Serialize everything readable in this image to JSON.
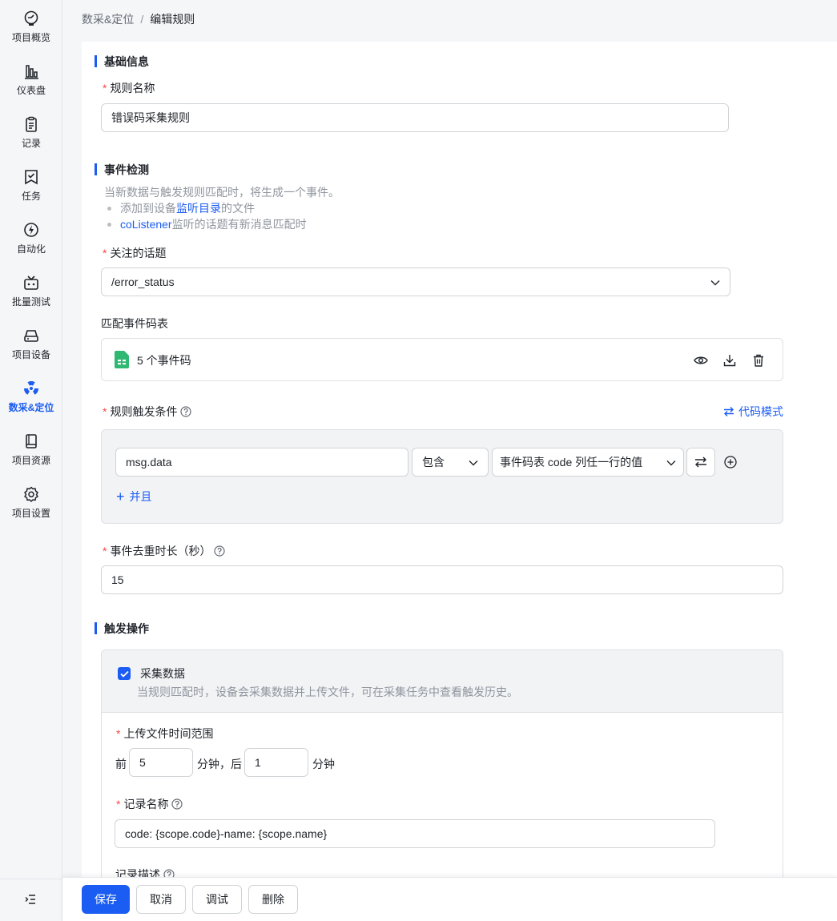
{
  "nav": [
    {
      "label": "项目概览",
      "icon": "dashboard-gauge-icon",
      "active": false
    },
    {
      "label": "仪表盘",
      "icon": "bar-chart-icon",
      "active": false
    },
    {
      "label": "记录",
      "icon": "clipboard-icon",
      "active": false
    },
    {
      "label": "任务",
      "icon": "task-checklist-icon",
      "active": false
    },
    {
      "label": "自动化",
      "icon": "automation-icon",
      "active": false
    },
    {
      "label": "批量测试",
      "icon": "batch-test-icon",
      "active": false
    },
    {
      "label": "项目设备",
      "icon": "device-drive-icon",
      "active": false
    },
    {
      "label": "数采&定位",
      "icon": "radiation-icon",
      "active": true
    },
    {
      "label": "项目资源",
      "icon": "book-icon",
      "active": false
    },
    {
      "label": "项目设置",
      "icon": "gear-icon",
      "active": false
    }
  ],
  "breadcrumb": {
    "parent": "数采&定位",
    "separator": "/",
    "current": "编辑规则"
  },
  "basic": {
    "title": "基础信息",
    "rule_name_label": "规则名称",
    "rule_name_value": "错误码采集规则"
  },
  "event": {
    "title": "事件检测",
    "desc": "当新数据与触发规则匹配时，将生成一个事件。",
    "bullet1_prefix": "添加到设备",
    "bullet1_link": "监听目录",
    "bullet1_suffix": "的文件",
    "bullet2_link": "coListener",
    "bullet2_suffix": "监听的话题有新消息匹配时",
    "topic_label": "关注的话题",
    "topic_value": "/error_status",
    "code_table_label": "匹配事件码表",
    "code_table_file": "5 个事件码",
    "trigger_label": "规则触发条件",
    "code_mode": "代码模式",
    "condition_field": "msg.data",
    "condition_operator": "包含",
    "condition_value": "事件码表 code 列任一行的值",
    "and_label": "并且",
    "dedup_label": "事件去重时长（秒）",
    "dedup_value": "15"
  },
  "action": {
    "title": "触发操作",
    "collect_title": "采集数据",
    "collect_checked": true,
    "collect_desc": "当规则匹配时，设备会采集数据并上传文件，可在采集任务中查看触发历史。",
    "time_range_label": "上传文件时间范围",
    "before_label": "前",
    "before_value": "5",
    "after_prefix": "分钟，后",
    "after_value": "1",
    "after_suffix": "分钟",
    "record_name_label": "记录名称",
    "record_name_value": "code: {scope.code}-name: {scope.name}",
    "record_desc_label": "记录描述"
  },
  "footer": {
    "save": "保存",
    "cancel": "取消",
    "debug": "调试",
    "delete": "删除"
  },
  "colors": {
    "accent": "#1b5cf2",
    "required": "#f54a45",
    "file_green": "#2eb872"
  }
}
